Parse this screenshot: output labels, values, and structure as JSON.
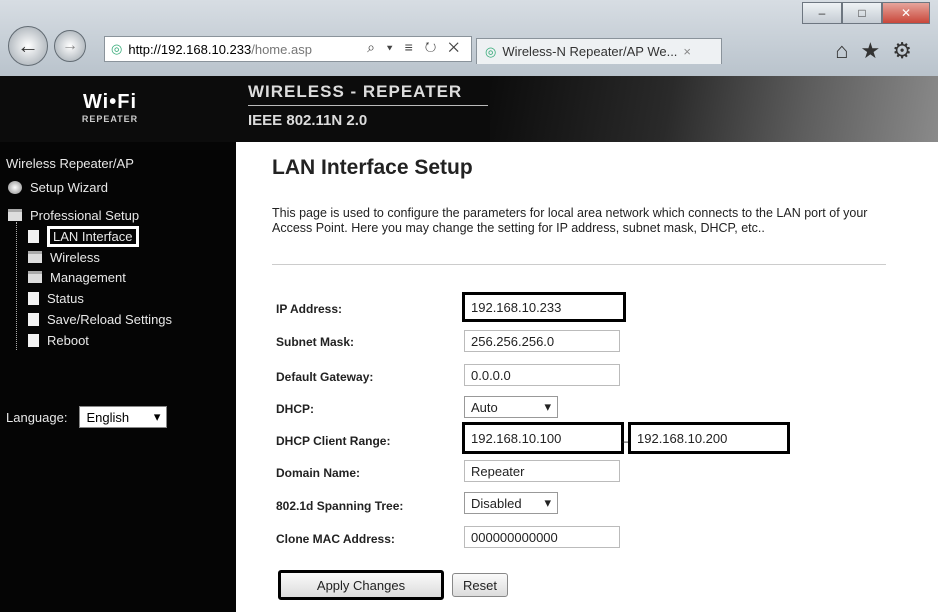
{
  "browser": {
    "url_host": "http://192.168.10.233",
    "url_path": "/home.asp",
    "addr_icons": "⌕ ▾ ≡ ↻ ✕",
    "tab_title": "Wireless-N Repeater/AP We...",
    "tab_close": "×",
    "win_min": "–",
    "win_max": "□",
    "win_close": "✕",
    "back": "←",
    "forward": "→",
    "toolbar_icons": "⌂★⚙"
  },
  "header": {
    "logo_main": "Wi•Fi",
    "logo_sub": "REPEATER",
    "title": "WIRELESS - REPEATER",
    "subtitle": "IEEE 802.11N 2.0"
  },
  "sidebar": {
    "heading": "Wireless Repeater/AP",
    "items": [
      {
        "label": "Setup Wizard"
      },
      {
        "label": "Professional Setup"
      },
      {
        "label": "LAN Interface"
      },
      {
        "label": "Wireless"
      },
      {
        "label": "Management"
      },
      {
        "label": "Status"
      },
      {
        "label": "Save/Reload Settings"
      },
      {
        "label": "Reboot"
      }
    ],
    "language_label": "Language:",
    "language_value": "English"
  },
  "main": {
    "title": "LAN Interface Setup",
    "description": "This page is used to configure the parameters for local area network which connects to the LAN port of your Access Point. Here you may change the setting for IP address, subnet mask, DHCP, etc..",
    "fields": {
      "ip_label": "IP Address:",
      "ip_value": "192.168.10.233",
      "subnet_label": "Subnet Mask:",
      "subnet_value": "256.256.256.0",
      "gateway_label": "Default Gateway:",
      "gateway_value": "0.0.0.0",
      "dhcp_label": "DHCP:",
      "dhcp_value": "Auto",
      "range_label": "DHCP Client Range:",
      "range_start": "192.168.10.100",
      "range_sep": "_",
      "range_end": "192.168.10.200",
      "domain_label": "Domain Name:",
      "domain_value": "Repeater",
      "stp_label": "802.1d Spanning Tree:",
      "stp_value": "Disabled",
      "mac_label": "Clone MAC Address:",
      "mac_value": "000000000000"
    },
    "apply_label": "Apply Changes",
    "reset_label": "Reset"
  }
}
